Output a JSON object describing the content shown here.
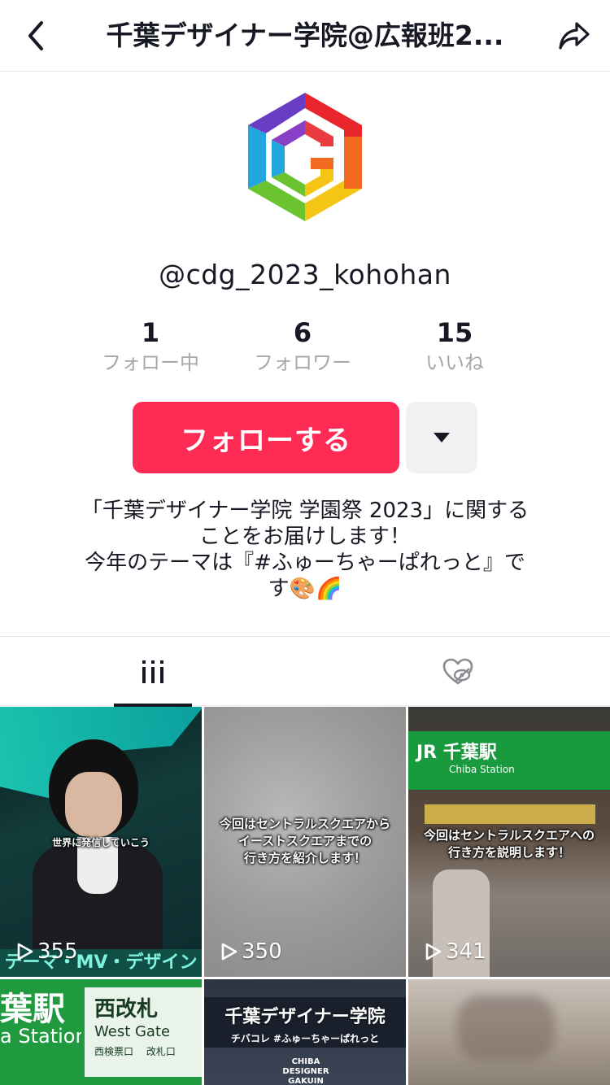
{
  "header": {
    "title": "千葉デザイナー学院@広報班2..."
  },
  "profile": {
    "handle": "@cdg_2023_kohohan",
    "stats": [
      {
        "value": "1",
        "label": "フォロー中"
      },
      {
        "value": "6",
        "label": "フォロワー"
      },
      {
        "value": "15",
        "label": "いいね"
      }
    ],
    "follow_label": "フォローする",
    "bio_lines": [
      "「千葉デザイナー学院 学園祭 2023」に関する",
      "ことをお届けします！",
      "今年のテーマは『#ふゅーちゃーぱれっと』で",
      "す🎨🌈"
    ]
  },
  "colors": {
    "accent": "#fe2c55",
    "text": "#161823",
    "muted": "#a8a8ac"
  },
  "videos": [
    {
      "views": "355",
      "caption": "世界に発信していこう",
      "overlay_bottom": "テーマ・MV・デザイン"
    },
    {
      "views": "350",
      "caption": "今回はセントラルスクエアから\nイーストスクエアまでの\n行き方を紹介します！"
    },
    {
      "views": "341",
      "caption": "今回はセントラルスクエアへの\n行き方を説明します！",
      "sign_top": "JR 千葉駅",
      "sign_sub": "Chiba Station"
    },
    {
      "sign_main": "葉駅",
      "sign_sub": "a Station",
      "sign_right": "西改札",
      "sign_right_sub": "West Gate",
      "sign_small": "西検票口　 改札口"
    },
    {
      "banner_title": "千葉デザイナー学院",
      "banner_sub": "チバコレ #ふゅーちゃーぱれっと",
      "building": "CHIBA DESIGNER GAKUIN"
    },
    {}
  ]
}
